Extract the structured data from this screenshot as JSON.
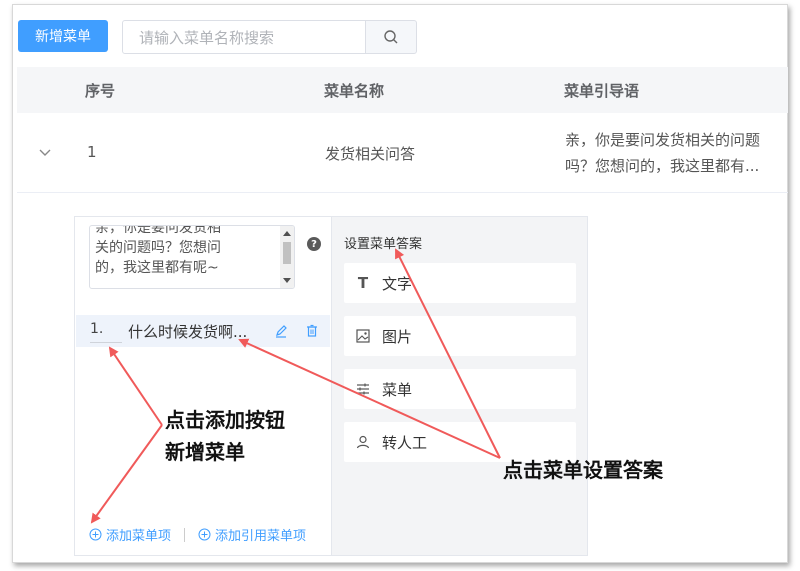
{
  "toolbar": {
    "add_label": "新增菜单",
    "search_placeholder": "请输入菜单名称搜索"
  },
  "table": {
    "headers": [
      "序号",
      "菜单名称",
      "菜单引导语"
    ],
    "rows": [
      {
        "index": "1",
        "name": "发货相关问答",
        "guide_line1": "亲，你是要问发货相关的问题",
        "guide_line2": "吗？您想问的，我这里都有..."
      }
    ]
  },
  "expand": {
    "textarea_lines": [
      "亲，你是要问发货相",
      "关的问题吗？您想问",
      "的，我这里都有呢~"
    ],
    "menu_items": [
      {
        "num": "1.",
        "label": "什么时候发货啊..."
      }
    ],
    "add_item_label": "添加菜单项",
    "add_ref_item_label": "添加引用菜单项",
    "answer_title": "设置菜单答案",
    "answer_types": [
      {
        "icon": "text-icon",
        "label": "文字"
      },
      {
        "icon": "image-icon",
        "label": "图片"
      },
      {
        "icon": "menu-icon",
        "label": "菜单"
      },
      {
        "icon": "person-icon",
        "label": "转人工"
      }
    ]
  },
  "annotations": {
    "left_line1": "点击添加按钮",
    "left_line2": "新增菜单",
    "right": "点击菜单设置答案",
    "arrow_color": "#f05a5a"
  }
}
